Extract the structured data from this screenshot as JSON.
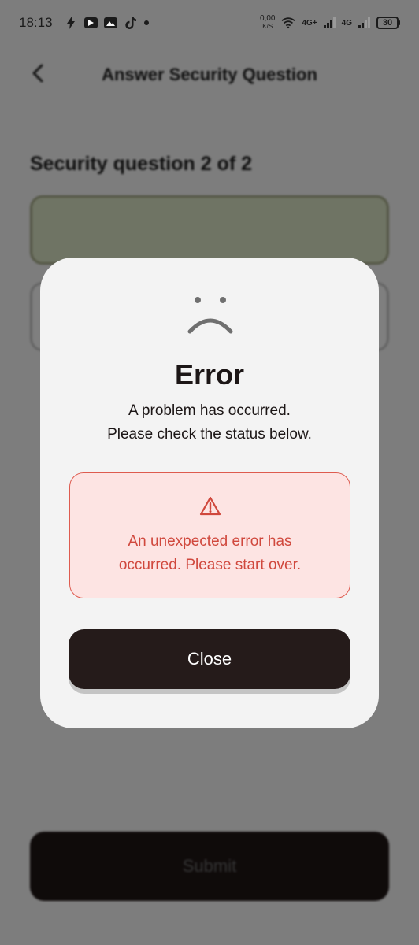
{
  "status_bar": {
    "time": "18:13",
    "left_icons": [
      "bolt-icon",
      "youtube-icon",
      "gallery-icon",
      "tiktok-icon",
      "dot-icon"
    ],
    "net_speed_value": "0,00",
    "net_speed_unit": "K/S",
    "network_1": "4G+",
    "network_2": "4G",
    "battery": "30"
  },
  "background": {
    "header_title": "Answer Security Question",
    "section_heading": "Security question 2 of 2",
    "submit_label": "Submit",
    "colors": {
      "question_box_fill": "#dfe8c8",
      "submit_fill": "#1f1615"
    }
  },
  "dialog": {
    "icon": "sad-face-icon",
    "title": "Error",
    "message_lines": [
      "A problem has occurred.",
      "Please check the status below."
    ],
    "error_icon": "warning-icon",
    "error_lines": [
      "An unexpected error has",
      "occurred. Please start over."
    ],
    "close_label": "Close",
    "colors": {
      "error_text": "#d0483d",
      "error_bg": "#fde4e3",
      "button_bg": "#251b1a"
    }
  }
}
